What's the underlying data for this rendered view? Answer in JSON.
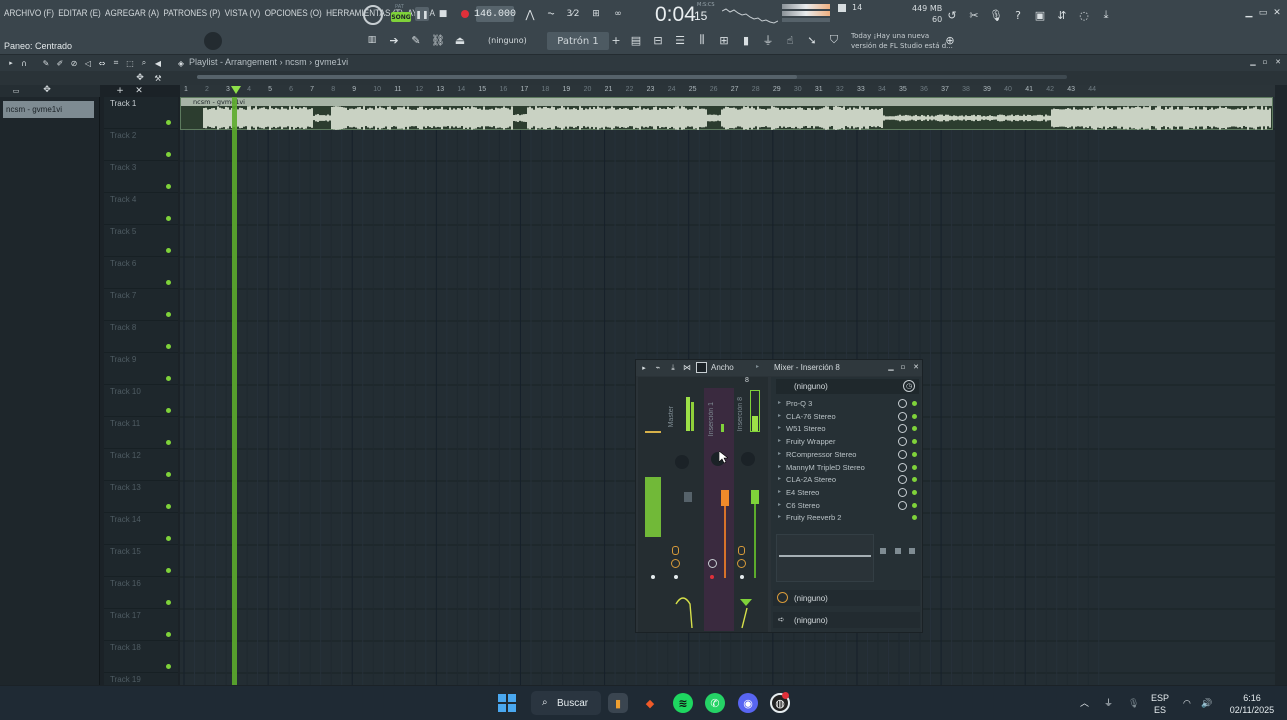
{
  "menu": {
    "items": [
      "ARCHIVO (F)",
      "EDITAR (E)",
      "AGREGAR (A)",
      "PATRONES (P)",
      "VISTA (V)",
      "OPCIONES (O)",
      "HERRAMIENTAS (T)",
      "AYUDA"
    ]
  },
  "transport": {
    "pat_label": "PAT",
    "song_label": "SONG",
    "tempo": "146.000",
    "time_main": "0:04",
    "time_sub": "15",
    "time_unit": "M:S:CS",
    "cpu": "14",
    "mem_line1": "449 MB",
    "mem_line2": "60"
  },
  "hint_bar": {
    "panning": "Paneo: Centrado",
    "snap": "(ninguno)",
    "pattern": "Patrón 1",
    "news_line1": "Today  ¡Hay una nueva",
    "news_line2": "versión de FL Studio está d..."
  },
  "playlist": {
    "title": "Playlist - Arrangement",
    "sep": "›",
    "crumb1": "ncsm",
    "crumb2": "gvme1vi",
    "picker_selected": "ncsm - gvme1vi",
    "clip_name": "ncsm - gvme1vi",
    "ruler": [
      "1",
      "2",
      "3",
      "4",
      "5",
      "6",
      "7",
      "8",
      "9",
      "10",
      "11",
      "12",
      "13",
      "14",
      "15",
      "16",
      "17",
      "18",
      "19",
      "20",
      "21",
      "22",
      "23",
      "24",
      "25",
      "26",
      "27",
      "28",
      "29",
      "30",
      "31",
      "32",
      "33",
      "34",
      "35",
      "36",
      "37",
      "38",
      "39",
      "40",
      "41",
      "42",
      "43",
      "44"
    ],
    "tracks": [
      "Track 1",
      "Track 2",
      "Track 3",
      "Track 4",
      "Track 5",
      "Track 6",
      "Track 7",
      "Track 8",
      "Track 9",
      "Track 10",
      "Track 11",
      "Track 12",
      "Track 13",
      "Track 14",
      "Track 15",
      "Track 16",
      "Track 17",
      "Track 18",
      "Track 19"
    ]
  },
  "mixer": {
    "width_label": "Ancho",
    "title": "Mixer - Inserción 8",
    "master_label": "Master",
    "insert1_label": "Inserción 1",
    "insert8_label": "Inserción 8",
    "insert_num": "8",
    "slot_none": "(ninguno)",
    "fx": [
      "Pro-Q 3",
      "CLA-76 Stereo",
      "W51 Stereo",
      "Fruity Wrapper",
      "RCompressor Stereo",
      "MannyM TripleD Stereo",
      "CLA-2A Stereo",
      "E4 Stereo",
      "C6 Stereo",
      "Fruity Reeverb 2"
    ],
    "in_slot": "(ninguno)",
    "out_slot": "(ninguno)"
  },
  "taskbar": {
    "search": "Buscar",
    "lang1": "ESP",
    "lang2": "ES",
    "time": "6:16",
    "date": "02/11/2025"
  },
  "colors": {
    "accent_green": "#7fd23a",
    "playhead": "#5cab2c",
    "record": "#e0303a"
  }
}
